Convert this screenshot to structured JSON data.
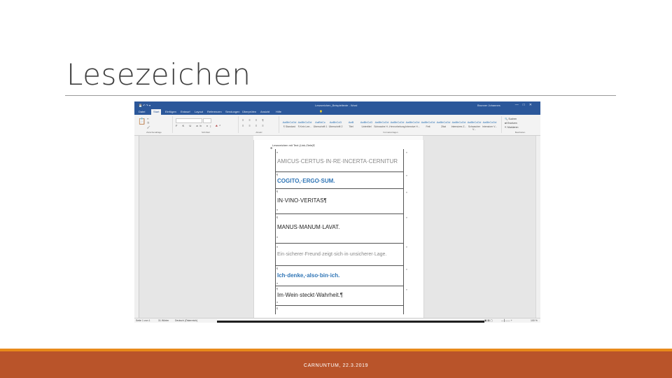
{
  "slide": {
    "title": "Lesezeichen",
    "footer": "CARNUNTUM, 22.3.2019"
  },
  "window": {
    "title": "Lesezeichen_Beispieltexte - Word",
    "user": "Brunner Johannes",
    "title_bar_color": "#2b579a"
  },
  "menu": [
    "Datei",
    "Start",
    "Einfügen",
    "Entwurf",
    "Layout",
    "Referenzen",
    "Sendungen",
    "Überprüfen",
    "Ansicht",
    "Hilfe"
  ],
  "ribbon": {
    "groups": [
      "Zwischenablage",
      "Schriftart",
      "Absatz",
      "Formatvorlagen",
      "Bearbeiten"
    ],
    "styles": [
      {
        "sample": "AaBbCcDd",
        "name": "¶ Standard"
      },
      {
        "sample": "AaBbCcDd",
        "name": "¶ Kein Lee..."
      },
      {
        "sample": "AaBbCc",
        "name": "Überschrift 1"
      },
      {
        "sample": "AaBbCcD",
        "name": "Überschrift 2"
      },
      {
        "sample": "AaB",
        "name": "Titel"
      },
      {
        "sample": "AaBbCcD",
        "name": "Untertitel"
      },
      {
        "sample": "AaBbCcDd",
        "name": "Schwache H..."
      },
      {
        "sample": "AaBbCcDd",
        "name": "Hervorhebung"
      },
      {
        "sample": "AaBbCcDd",
        "name": "Intensive H..."
      },
      {
        "sample": "AaBbCcDd",
        "name": "Fett"
      },
      {
        "sample": "AaBbCcDd",
        "name": "Zitat"
      },
      {
        "sample": "AaBbCcDd",
        "name": "Intensives Z..."
      },
      {
        "sample": "AaBbCcDd",
        "name": "Schwacher V..."
      },
      {
        "sample": "AaBbCcDd",
        "name": "Intensiver V..."
      }
    ],
    "edit": [
      "Suchen",
      "Ersetzen",
      "Markieren"
    ]
  },
  "document": {
    "bookmark_title": "Lesezeichen mit Text (Link-Ziele)¶",
    "rows": [
      {
        "text": "AMICUS·CERTUS·IN·RE·INCERTA·CERNITUR",
        "style": "gray"
      },
      {
        "text": "COGITO,·ERGO·SUM.",
        "style": "blue"
      },
      {
        "text": "IN·VINO·VERITAS¶",
        "style": "normal"
      },
      {
        "text": "MANUS·MANUM·LAVAT.",
        "style": "normal"
      },
      {
        "text": "Ein·sicherer·Freund·zeigt·sich·in·unsicherer·Lage.",
        "style": "gray"
      },
      {
        "text": "Ich·denke,·also·bin·ich.",
        "style": "blue"
      },
      {
        "text": "Im·Wein·steckt·Wahrheit.¶",
        "style": "normal"
      }
    ]
  },
  "status": {
    "page": "Seite 1 von 1",
    "words": "31 Wörter",
    "language": "Deutsch (Österreich)",
    "zoom": "100 %"
  },
  "colors": {
    "accent_blue": "#2e74b5",
    "footer_orange": "#e88a1a",
    "footer_brown": "#b9542a"
  }
}
